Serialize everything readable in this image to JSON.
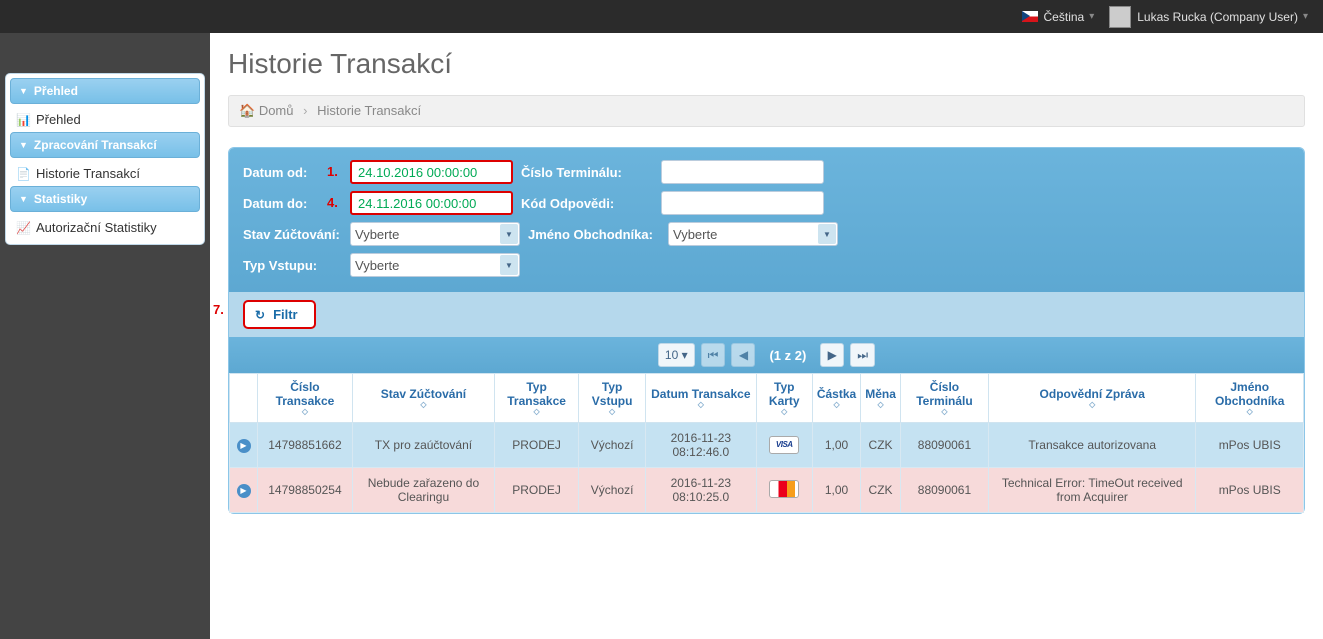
{
  "topbar": {
    "language": "Čeština",
    "user": "Lukas Rucka (Company User)"
  },
  "sidebar": {
    "groups": [
      {
        "title": "Přehled",
        "items": [
          {
            "icon": "📊",
            "label": "Přehled"
          }
        ]
      },
      {
        "title": "Zpracování Transakcí",
        "items": [
          {
            "icon": "📄",
            "label": "Historie Transakcí"
          }
        ]
      },
      {
        "title": "Statistiky",
        "items": [
          {
            "icon": "📈",
            "label": "Autorizační Statistiky"
          }
        ]
      }
    ]
  },
  "page": {
    "title": "Historie Transakcí",
    "breadcrumb_home": "Domů",
    "breadcrumb_current": "Historie Transakcí"
  },
  "filter": {
    "date_from_label": "Datum od:",
    "date_from_value": "24.10.2016 00:00:00",
    "date_from_annot": "1.",
    "date_to_label": "Datum do:",
    "date_to_value": "24.11.2016 00:00:00",
    "date_to_annot": "4.",
    "clearing_label": "Stav Zúčtování:",
    "clearing_value": "Vyberte",
    "entry_label": "Typ Vstupu:",
    "entry_value": "Vyberte",
    "terminal_label": "Číslo Terminálu:",
    "terminal_value": "",
    "response_label": "Kód Odpovědi:",
    "response_value": "",
    "merchant_label": "Jméno Obchodníka:",
    "merchant_value": "Vyberte",
    "filter_btn": "Filtr",
    "filter_annot": "7."
  },
  "pager": {
    "page_size": "10 ▾",
    "first": "⏮",
    "prev": "◀",
    "text": "(1 z 2)",
    "next": "▶",
    "last": "⏭"
  },
  "table": {
    "headers": [
      "",
      "Číslo Transakce",
      "Stav Zúčtování",
      "Typ Transakce",
      "Typ Vstupu",
      "Datum Transakce",
      "Typ Karty",
      "Částka",
      "Měna",
      "Číslo Terminálu",
      "Odpovědní Zpráva",
      "Jméno Obchodníka"
    ],
    "rows": [
      {
        "cls": "r0",
        "cells": [
          "14798851662",
          "TX pro zaúčtování",
          "PRODEJ",
          "Výchozí",
          "2016-11-23 08:12:46.0",
          "VISA",
          "1,00",
          "CZK",
          "88090061",
          "Transakce autorizovana",
          "mPos UBIS"
        ],
        "card": "visa"
      },
      {
        "cls": "r1",
        "cells": [
          "14798850254",
          "Nebude zařazeno do Clearingu",
          "PRODEJ",
          "Výchozí",
          "2016-11-23 08:10:25.0",
          "MC",
          "1,00",
          "CZK",
          "88090061",
          "Technical Error: TimeOut received from Acquirer",
          "mPos UBIS"
        ],
        "card": "mc"
      }
    ]
  }
}
